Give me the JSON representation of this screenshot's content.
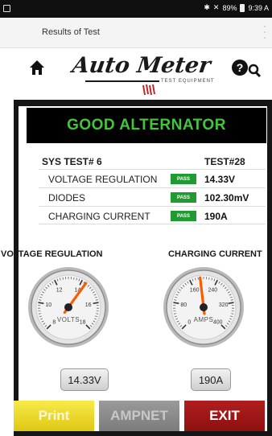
{
  "status_bar": {
    "battery": "89%",
    "time": "9:39 A"
  },
  "app_bar": {
    "title": "Results of Test"
  },
  "brand": {
    "logo_text": "Auto Meter",
    "logo_subtext": "TEST EQUIPMENT"
  },
  "result": {
    "banner": "GOOD ALTERNATOR",
    "sys_test": "SYS TEST# 6",
    "test_number": "TEST#28",
    "rows": [
      {
        "label": "VOLTAGE REGULATION",
        "status": "PASS",
        "value": "14.33V"
      },
      {
        "label": "DIODES",
        "status": "PASS",
        "value": "102.30mV"
      },
      {
        "label": "CHARGING CURRENT",
        "status": "PASS",
        "value": "190A"
      }
    ]
  },
  "gauges": [
    {
      "title": "VOLTAGE REGULATION",
      "unit_label": "VOLTS",
      "ticks": [
        "8",
        "10",
        "12",
        "14",
        "16",
        "18"
      ],
      "min": 8,
      "max": 18,
      "reading": 14.33,
      "readout": "14.33V"
    },
    {
      "title": "CHARGING CURRENT",
      "unit_label": "AMPS",
      "ticks": [
        "0",
        "80",
        "160",
        "240",
        "320",
        "400"
      ],
      "min": 0,
      "max": 400,
      "reading": 190,
      "readout": "190A"
    }
  ],
  "buttons": {
    "print": "Print",
    "ampnet": "AMPNET",
    "exit": "EXIT"
  },
  "colors": {
    "pass_badge": "#1f9b32",
    "banner_text": "#43c53b",
    "needle": "#ff5a00",
    "print_button": "#e8d51f",
    "exit_button": "#a01818"
  }
}
